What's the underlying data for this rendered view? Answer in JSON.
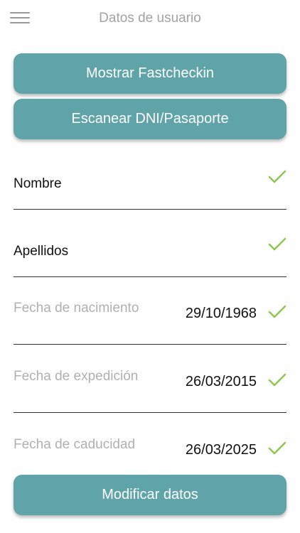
{
  "header": {
    "title": "Datos de usuario",
    "menu_icon": "hamburger-menu-icon"
  },
  "buttons": {
    "fastcheckin": "Mostrar Fastcheckin",
    "scan": "Escanear DNI/Pasaporte",
    "modify": "Modificar datos"
  },
  "fields": [
    {
      "label": "Nombre",
      "value": ""
    },
    {
      "label": "Apellidos",
      "value": ""
    },
    {
      "label": "Fecha de nacimiento",
      "value": "29/10/1968"
    },
    {
      "label": "Fecha de expedición",
      "value": "26/03/2015"
    },
    {
      "label": "Fecha de caducidad",
      "value": "26/03/2025"
    }
  ],
  "colors": {
    "accent": "#5fa4a8",
    "check": "#8cc84b",
    "placeholder": "#b0b0b0"
  }
}
